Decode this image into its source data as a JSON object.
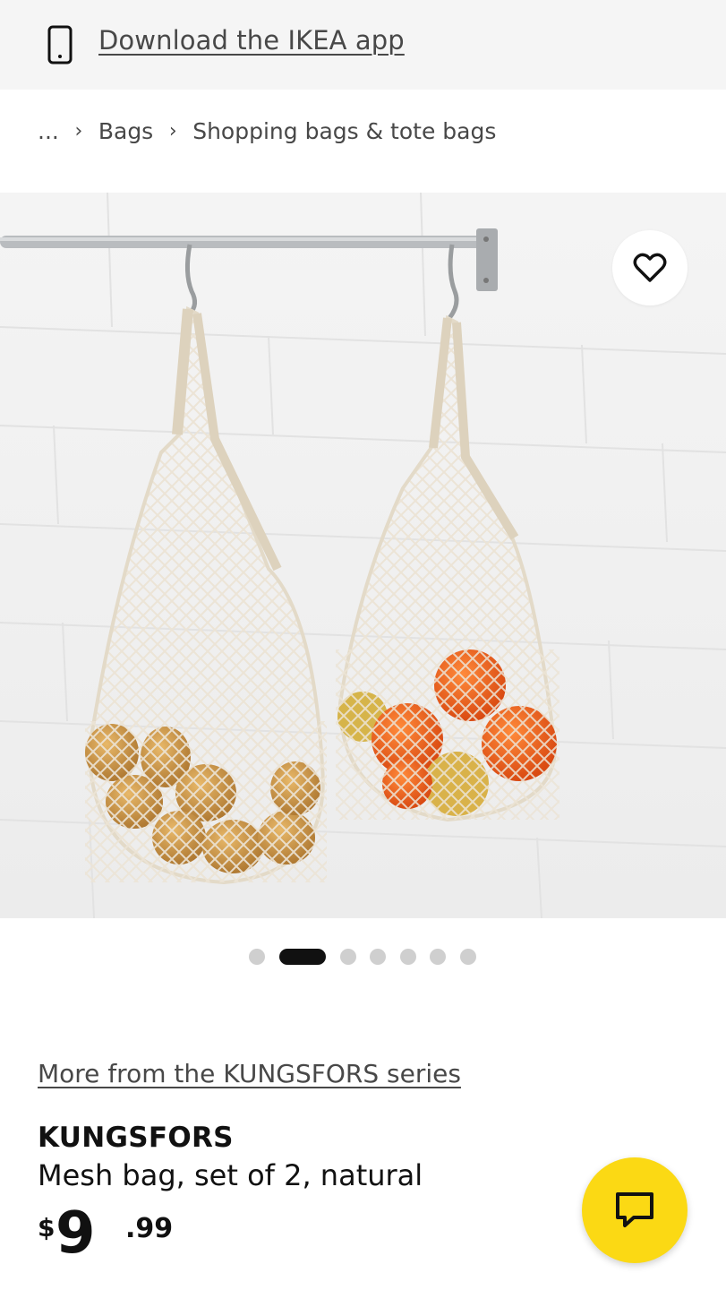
{
  "banner": {
    "link_text": "Download the IKEA app",
    "icon": "smartphone-icon"
  },
  "breadcrumb": {
    "items": [
      "...",
      "Bags",
      "Shopping bags & tote bags"
    ],
    "separator_icon": "chevron-right-icon"
  },
  "gallery": {
    "total_images": 7,
    "active_index": 1,
    "favorite_icon": "heart-icon"
  },
  "product": {
    "series_link": "More from the KUNGSFORS series",
    "name": "KUNGSFORS",
    "description": "Mesh bag, set of 2, natural",
    "price": {
      "currency": "$",
      "integer": "9",
      "decimal": ".99"
    }
  },
  "chat": {
    "icon": "chat-bubble-icon"
  },
  "colors": {
    "banner_bg": "#f5f5f5",
    "text_primary": "#111111",
    "text_secondary": "#484848",
    "chat_yellow": "#fbd914",
    "dot_active": "#111111",
    "dot_inactive": "#cfcfcf"
  }
}
